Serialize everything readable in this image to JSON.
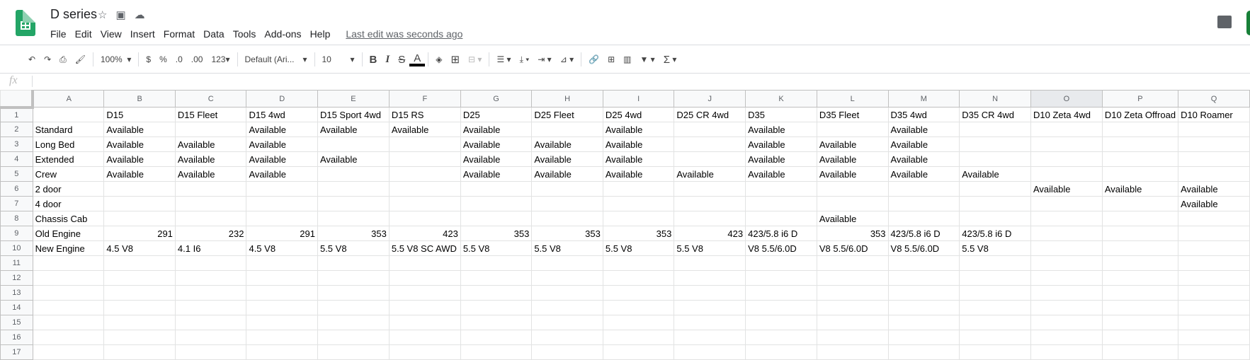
{
  "doc": {
    "title": "D series",
    "last_edit": "Last edit was seconds ago"
  },
  "menu": [
    "File",
    "Edit",
    "View",
    "Insert",
    "Format",
    "Data",
    "Tools",
    "Add-ons",
    "Help"
  ],
  "toolbar": {
    "zoom": "100%",
    "currency": "$",
    "percent": "%",
    "dec_decrease": ".0",
    "dec_increase": ".00",
    "format_more": "123",
    "font": "Default (Ari...",
    "font_size": "10",
    "bold": "B",
    "italic": "I",
    "strike": "S",
    "text_color": "A",
    "sum": "Σ"
  },
  "formula_bar": {
    "fx": "fx",
    "value": ""
  },
  "selected_column": "O",
  "columns": [
    "A",
    "B",
    "C",
    "D",
    "E",
    "F",
    "G",
    "H",
    "I",
    "J",
    "K",
    "L",
    "M",
    "N",
    "O",
    "P",
    "Q"
  ],
  "rows": [
    [
      "",
      "D15",
      "D15 Fleet",
      "D15 4wd",
      "D15 Sport 4wd",
      "D15 RS",
      "D25",
      "D25 Fleet",
      "D25 4wd",
      "D25 CR 4wd",
      "D35",
      "D35 Fleet",
      "D35 4wd",
      "D35 CR 4wd",
      "D10 Zeta 4wd",
      "D10 Zeta Offroad",
      "D10 Roamer"
    ],
    [
      "Standard",
      "Available",
      "",
      "Available",
      "Available",
      "Available",
      "Available",
      "",
      "Available",
      "",
      "Available",
      "",
      "Available",
      "",
      "",
      "",
      ""
    ],
    [
      "Long Bed",
      "Available",
      "Available",
      "Available",
      "",
      "",
      "Available",
      "Available",
      "Available",
      "",
      "Available",
      "Available",
      "Available",
      "",
      "",
      "",
      ""
    ],
    [
      "Extended",
      "Available",
      "Available",
      "Available",
      "Available",
      "",
      "Available",
      "Available",
      "Available",
      "",
      "Available",
      "Available",
      "Available",
      "",
      "",
      "",
      ""
    ],
    [
      "Crew",
      "Available",
      "Available",
      "Available",
      "",
      "",
      "Available",
      "Available",
      "Available",
      "Available",
      "Available",
      "Available",
      "Available",
      "Available",
      "",
      "",
      ""
    ],
    [
      "2 door",
      "",
      "",
      "",
      "",
      "",
      "",
      "",
      "",
      "",
      "",
      "",
      "",
      "",
      "Available",
      "Available",
      "Available"
    ],
    [
      "4 door",
      "",
      "",
      "",
      "",
      "",
      "",
      "",
      "",
      "",
      "",
      "",
      "",
      "",
      "",
      "",
      "Available"
    ],
    [
      "Chassis Cab",
      "",
      "",
      "",
      "",
      "",
      "",
      "",
      "",
      "",
      "",
      "Available",
      "",
      "",
      "",
      "",
      ""
    ],
    [
      "Old Engine",
      291,
      232,
      291,
      353,
      423,
      353,
      353,
      353,
      423,
      "423/5.8 i6 D",
      353,
      "423/5.8 i6 D",
      "423/5.8 i6 D",
      "",
      "",
      ""
    ],
    [
      "New Engine",
      "4.5 V8",
      "4.1 I6",
      "4.5 V8",
      "5.5 V8",
      "5.5 V8 SC AWD",
      "5.5 V8",
      "5.5 V8",
      "5.5 V8",
      "5.5 V8",
      "V8 5.5/6.0D",
      "V8 5.5/6.0D",
      "V8 5.5/6.0D",
      "5.5 V8",
      "",
      "",
      ""
    ],
    [
      "",
      "",
      "",
      "",
      "",
      "",
      "",
      "",
      "",
      "",
      "",
      "",
      "",
      "",
      "",
      "",
      ""
    ],
    [
      "",
      "",
      "",
      "",
      "",
      "",
      "",
      "",
      "",
      "",
      "",
      "",
      "",
      "",
      "",
      "",
      ""
    ],
    [
      "",
      "",
      "",
      "",
      "",
      "",
      "",
      "",
      "",
      "",
      "",
      "",
      "",
      "",
      "",
      "",
      ""
    ],
    [
      "",
      "",
      "",
      "",
      "",
      "",
      "",
      "",
      "",
      "",
      "",
      "",
      "",
      "",
      "",
      "",
      ""
    ],
    [
      "",
      "",
      "",
      "",
      "",
      "",
      "",
      "",
      "",
      "",
      "",
      "",
      "",
      "",
      "",
      "",
      ""
    ],
    [
      "",
      "",
      "",
      "",
      "",
      "",
      "",
      "",
      "",
      "",
      "",
      "",
      "",
      "",
      "",
      "",
      ""
    ],
    [
      "",
      "",
      "",
      "",
      "",
      "",
      "",
      "",
      "",
      "",
      "",
      "",
      "",
      "",
      "",
      "",
      ""
    ]
  ]
}
